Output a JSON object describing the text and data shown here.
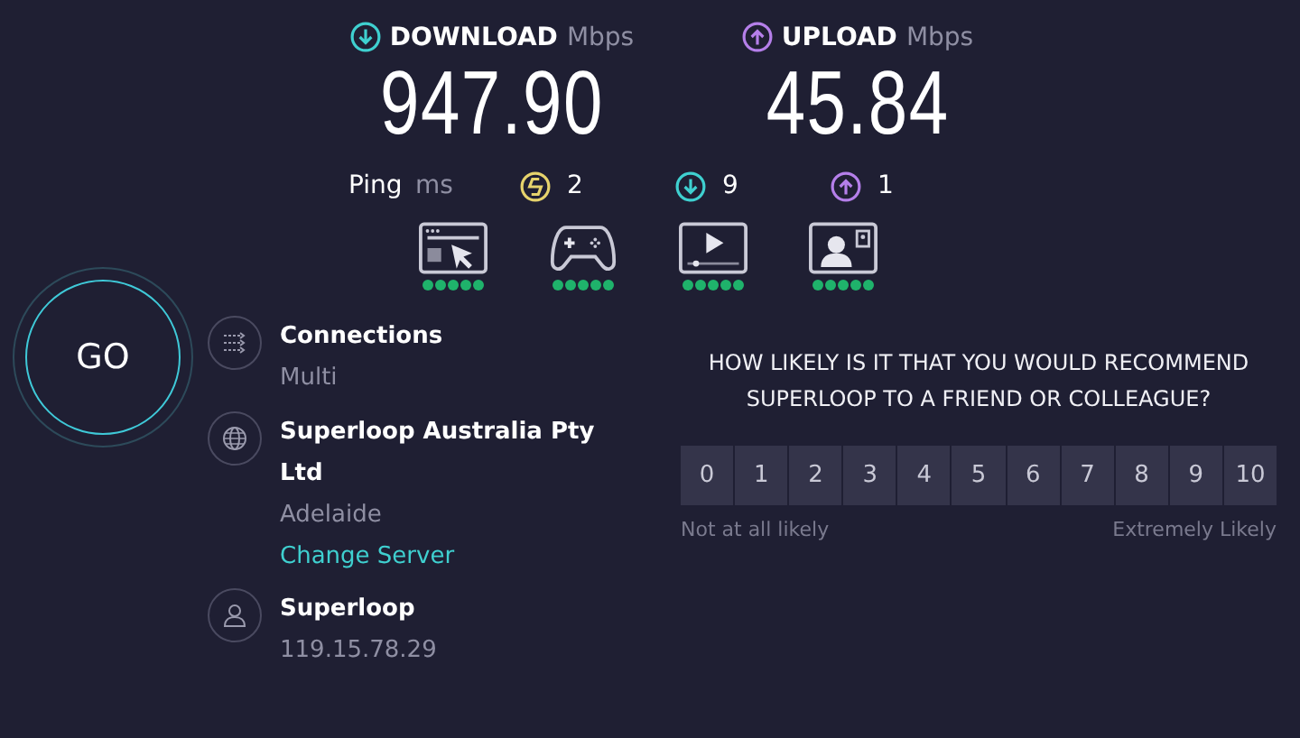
{
  "go_button": {
    "label": "GO"
  },
  "speeds": [
    {
      "kind": "download",
      "label": "DOWNLOAD",
      "unit": "Mbps",
      "value": "947.90"
    },
    {
      "kind": "upload",
      "label": "UPLOAD",
      "unit": "Mbps",
      "value": "45.84"
    }
  ],
  "ping": {
    "label": "Ping",
    "unit": "ms",
    "readings": [
      {
        "kind": "idle",
        "color": "#e6d36c",
        "value": "2"
      },
      {
        "kind": "download",
        "color": "#3fd0d0",
        "value": "9"
      },
      {
        "kind": "upload",
        "color": "#b57fea",
        "value": "1"
      }
    ]
  },
  "ratings": [
    {
      "kind": "browsing",
      "stars": 5
    },
    {
      "kind": "gaming",
      "stars": 5
    },
    {
      "kind": "streaming",
      "stars": 5
    },
    {
      "kind": "video_call",
      "stars": 5
    }
  ],
  "server_info": [
    {
      "kind": "connections",
      "title": "Connections",
      "lines": [
        {
          "text": "Multi",
          "kind": "detail"
        }
      ]
    },
    {
      "kind": "server",
      "title": "Superloop Australia Pty Ltd",
      "lines": [
        {
          "text": "Adelaide",
          "kind": "detail"
        },
        {
          "text": "Change Server",
          "kind": "link"
        }
      ]
    },
    {
      "kind": "provider",
      "title": "Superloop",
      "lines": [
        {
          "text": "119.15.78.29",
          "kind": "detail"
        }
      ]
    }
  ],
  "survey": {
    "question": "HOW LIKELY IS IT THAT YOU WOULD RECOMMEND SUPERLOOP TO A FRIEND OR COLLEAGUE?",
    "options": [
      {
        "label": "0",
        "selected": false
      },
      {
        "label": "1",
        "selected": false
      },
      {
        "label": "2",
        "selected": false
      },
      {
        "label": "3",
        "selected": false
      },
      {
        "label": "4",
        "selected": false
      },
      {
        "label": "5",
        "selected": false
      },
      {
        "label": "6",
        "selected": false
      },
      {
        "label": "7",
        "selected": false
      },
      {
        "label": "8",
        "selected": false
      },
      {
        "label": "9",
        "selected": false
      },
      {
        "label": "10",
        "selected": false
      }
    ],
    "low_label": "Not at all likely",
    "high_label": "Extremely Likely"
  }
}
